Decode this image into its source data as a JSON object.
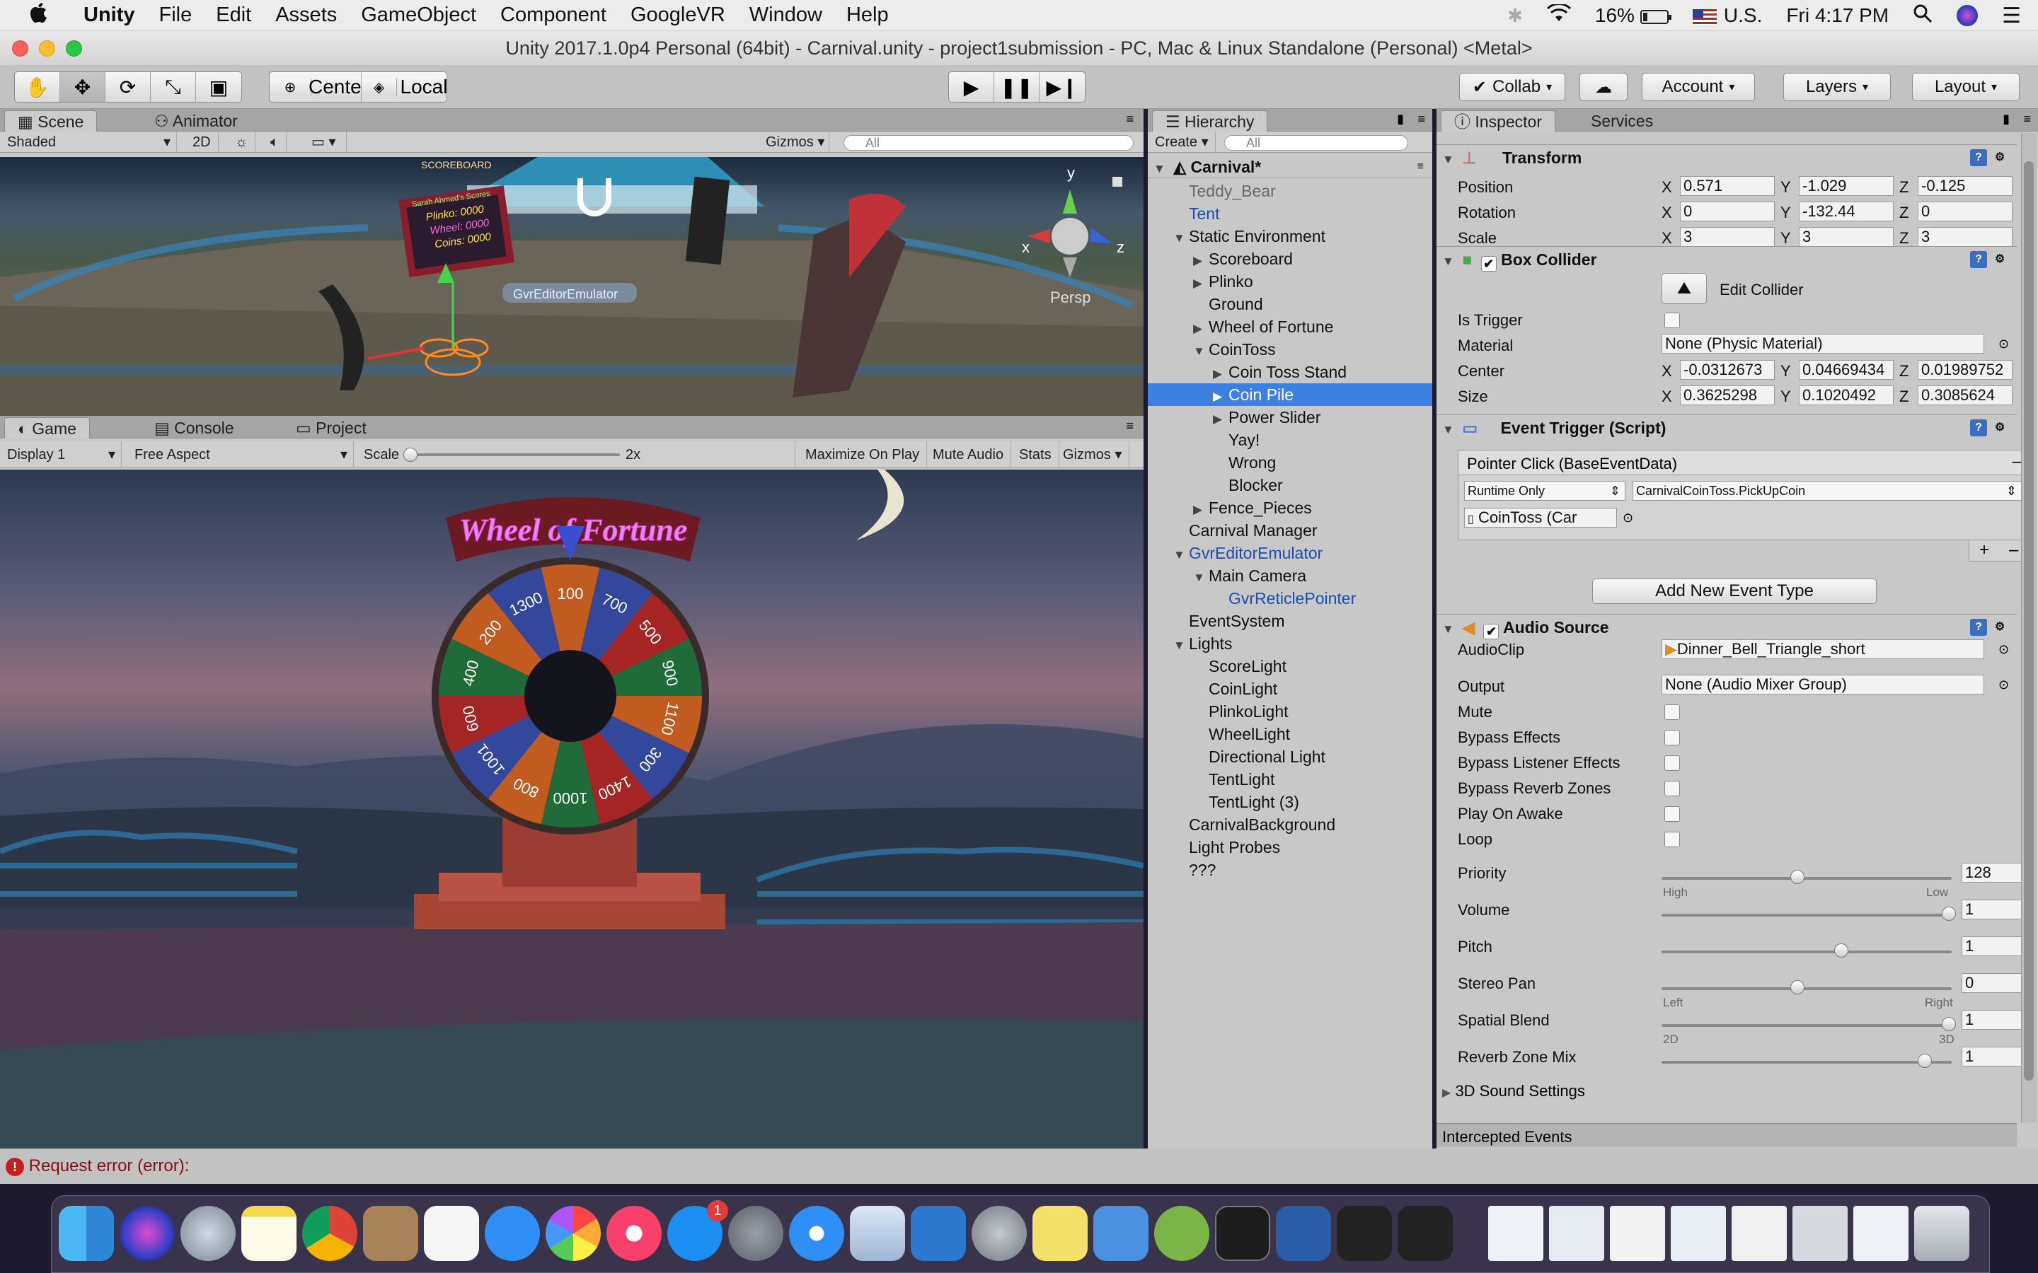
{
  "menubar": {
    "app": "Unity",
    "items": [
      "File",
      "Edit",
      "Assets",
      "GameObject",
      "Component",
      "GoogleVR",
      "Window",
      "Help"
    ],
    "battery": "16%",
    "input_source": "U.S.",
    "clock": "Fri 4:17 PM"
  },
  "window": {
    "title": "Unity 2017.1.0p4 Personal (64bit) - Carnival.unity - project1submission - PC, Mac & Linux Standalone (Personal) <Metal>"
  },
  "toolbar": {
    "pivot": "Center",
    "space": "Local",
    "collab": "Collab",
    "account": "Account",
    "layers": "Layers",
    "layout": "Layout"
  },
  "scene_panel": {
    "tabs": [
      "Scene",
      "Animator"
    ],
    "shading": "Shaded",
    "mode_2d": "2D",
    "gizmos": "Gizmos",
    "search_placeholder": "All",
    "persp": "Persp",
    "axis_x": "x",
    "axis_y": "y",
    "axis_z": "z",
    "sign_title": "SCOREBOARD",
    "sign_name": "Sarah Ahmed's Scores",
    "sign_lines": [
      "Plinko: 0000",
      "Wheel: 0000",
      "Coins: 0000"
    ],
    "emulator_label": "GvrEditorEmulator"
  },
  "game_panel": {
    "tabs": [
      "Game",
      "Console",
      "Project"
    ],
    "display": "Display 1",
    "aspect": "Free Aspect",
    "scale_label": "Scale",
    "scale_value": "2x",
    "buttons": [
      "Maximize On Play",
      "Mute Audio",
      "Stats",
      "Gizmos"
    ],
    "wheel_title": "Wheel of Fortune",
    "wheel_numbers": [
      "100",
      "700",
      "500",
      "900",
      "1100",
      "300",
      "1400",
      "1000",
      "800",
      "1001",
      "600",
      "400",
      "200",
      "1300"
    ]
  },
  "hierarchy": {
    "tab": "Hierarchy",
    "create": "Create",
    "search_placeholder": "All",
    "scene": "Carnival*",
    "items": [
      {
        "label": "Teddy_Bear",
        "indent": 1,
        "arrow": "",
        "style": "dim"
      },
      {
        "label": "Tent",
        "indent": 1,
        "arrow": "",
        "style": "blue"
      },
      {
        "label": "Static Environment",
        "indent": 1,
        "arrow": "▼",
        "style": ""
      },
      {
        "label": "Scoreboard",
        "indent": 2,
        "arrow": "▶",
        "style": ""
      },
      {
        "label": "Plinko",
        "indent": 2,
        "arrow": "▶",
        "style": ""
      },
      {
        "label": "Ground",
        "indent": 2,
        "arrow": "",
        "style": ""
      },
      {
        "label": "Wheel of Fortune",
        "indent": 2,
        "arrow": "▶",
        "style": ""
      },
      {
        "label": "CoinToss",
        "indent": 2,
        "arrow": "▼",
        "style": ""
      },
      {
        "label": "Coin Toss Stand",
        "indent": 3,
        "arrow": "▶",
        "style": ""
      },
      {
        "label": "Coin Pile",
        "indent": 3,
        "arrow": "▶",
        "style": "sel"
      },
      {
        "label": "Power Slider",
        "indent": 3,
        "arrow": "▶",
        "style": ""
      },
      {
        "label": "Yay!",
        "indent": 3,
        "arrow": "",
        "style": ""
      },
      {
        "label": "Wrong",
        "indent": 3,
        "arrow": "",
        "style": ""
      },
      {
        "label": "Blocker",
        "indent": 3,
        "arrow": "",
        "style": ""
      },
      {
        "label": "Fence_Pieces",
        "indent": 2,
        "arrow": "▶",
        "style": ""
      },
      {
        "label": "Carnival Manager",
        "indent": 1,
        "arrow": "",
        "style": ""
      },
      {
        "label": "GvrEditorEmulator",
        "indent": 1,
        "arrow": "▼",
        "style": "blue"
      },
      {
        "label": "Main Camera",
        "indent": 2,
        "arrow": "▼",
        "style": ""
      },
      {
        "label": "GvrReticlePointer",
        "indent": 3,
        "arrow": "",
        "style": "blue"
      },
      {
        "label": "EventSystem",
        "indent": 1,
        "arrow": "",
        "style": ""
      },
      {
        "label": "Lights",
        "indent": 1,
        "arrow": "▼",
        "style": ""
      },
      {
        "label": "ScoreLight",
        "indent": 2,
        "arrow": "",
        "style": ""
      },
      {
        "label": "CoinLight",
        "indent": 2,
        "arrow": "",
        "style": ""
      },
      {
        "label": "PlinkoLight",
        "indent": 2,
        "arrow": "",
        "style": ""
      },
      {
        "label": "WheelLight",
        "indent": 2,
        "arrow": "",
        "style": ""
      },
      {
        "label": "Directional Light",
        "indent": 2,
        "arrow": "",
        "style": ""
      },
      {
        "label": "TentLight",
        "indent": 2,
        "arrow": "",
        "style": ""
      },
      {
        "label": "TentLight (3)",
        "indent": 2,
        "arrow": "",
        "style": ""
      },
      {
        "label": "CarnivalBackground",
        "indent": 1,
        "arrow": "",
        "style": ""
      },
      {
        "label": "Light Probes",
        "indent": 1,
        "arrow": "",
        "style": ""
      },
      {
        "label": "???",
        "indent": 1,
        "arrow": "",
        "style": ""
      }
    ]
  },
  "inspector": {
    "tabs": [
      "Inspector",
      "Services"
    ],
    "transform": {
      "title": "Transform",
      "position_label": "Position",
      "position": [
        "0.571",
        "-1.029",
        "-0.125"
      ],
      "rotation_label": "Rotation",
      "rotation": [
        "0",
        "-132.44",
        "0"
      ],
      "scale_label": "Scale",
      "scale": [
        "3",
        "3",
        "3"
      ]
    },
    "box_collider": {
      "title": "Box Collider",
      "edit_collider": "Edit Collider",
      "is_trigger_label": "Is Trigger",
      "material_label": "Material",
      "material": "None (Physic Material)",
      "center_label": "Center",
      "center": [
        "-0.0312673",
        "0.04669434",
        "0.01989752"
      ],
      "size_label": "Size",
      "size": [
        "0.3625298",
        "0.1020492",
        "0.3085624"
      ]
    },
    "event_trigger": {
      "title": "Event Trigger (Script)",
      "entry": "Pointer Click (BaseEventData)",
      "runtime": "Runtime Only",
      "function": "CarnivalCoinToss.PickUpCoin",
      "target": "CoinToss (Car",
      "add_button": "Add New Event Type"
    },
    "audio_source": {
      "title": "Audio Source",
      "audioclip_label": "AudioClip",
      "audioclip": "Dinner_Bell_Triangle_short",
      "output_label": "Output",
      "output": "None (Audio Mixer Group)",
      "toggles": [
        "Mute",
        "Bypass Effects",
        "Bypass Listener Effects",
        "Bypass Reverb Zones",
        "Play On Awake",
        "Loop"
      ],
      "priority_label": "Priority",
      "priority": "128",
      "priority_low": "High",
      "priority_high": "Low",
      "volume_label": "Volume",
      "volume": "1",
      "pitch_label": "Pitch",
      "pitch": "1",
      "stereo_label": "Stereo Pan",
      "stereo": "0",
      "stereo_left": "Left",
      "stereo_right": "Right",
      "spatial_label": "Spatial Blend",
      "spatial": "1",
      "spatial_min": "2D",
      "spatial_max": "3D",
      "reverb_label": "Reverb Zone Mix",
      "reverb": "1",
      "sound3d": "3D Sound Settings"
    },
    "intercepted": "Intercepted Events",
    "axis_labels": [
      "X",
      "Y",
      "Z"
    ]
  },
  "status": {
    "message": "Request error (error):"
  },
  "dock": {
    "badge": "1"
  }
}
